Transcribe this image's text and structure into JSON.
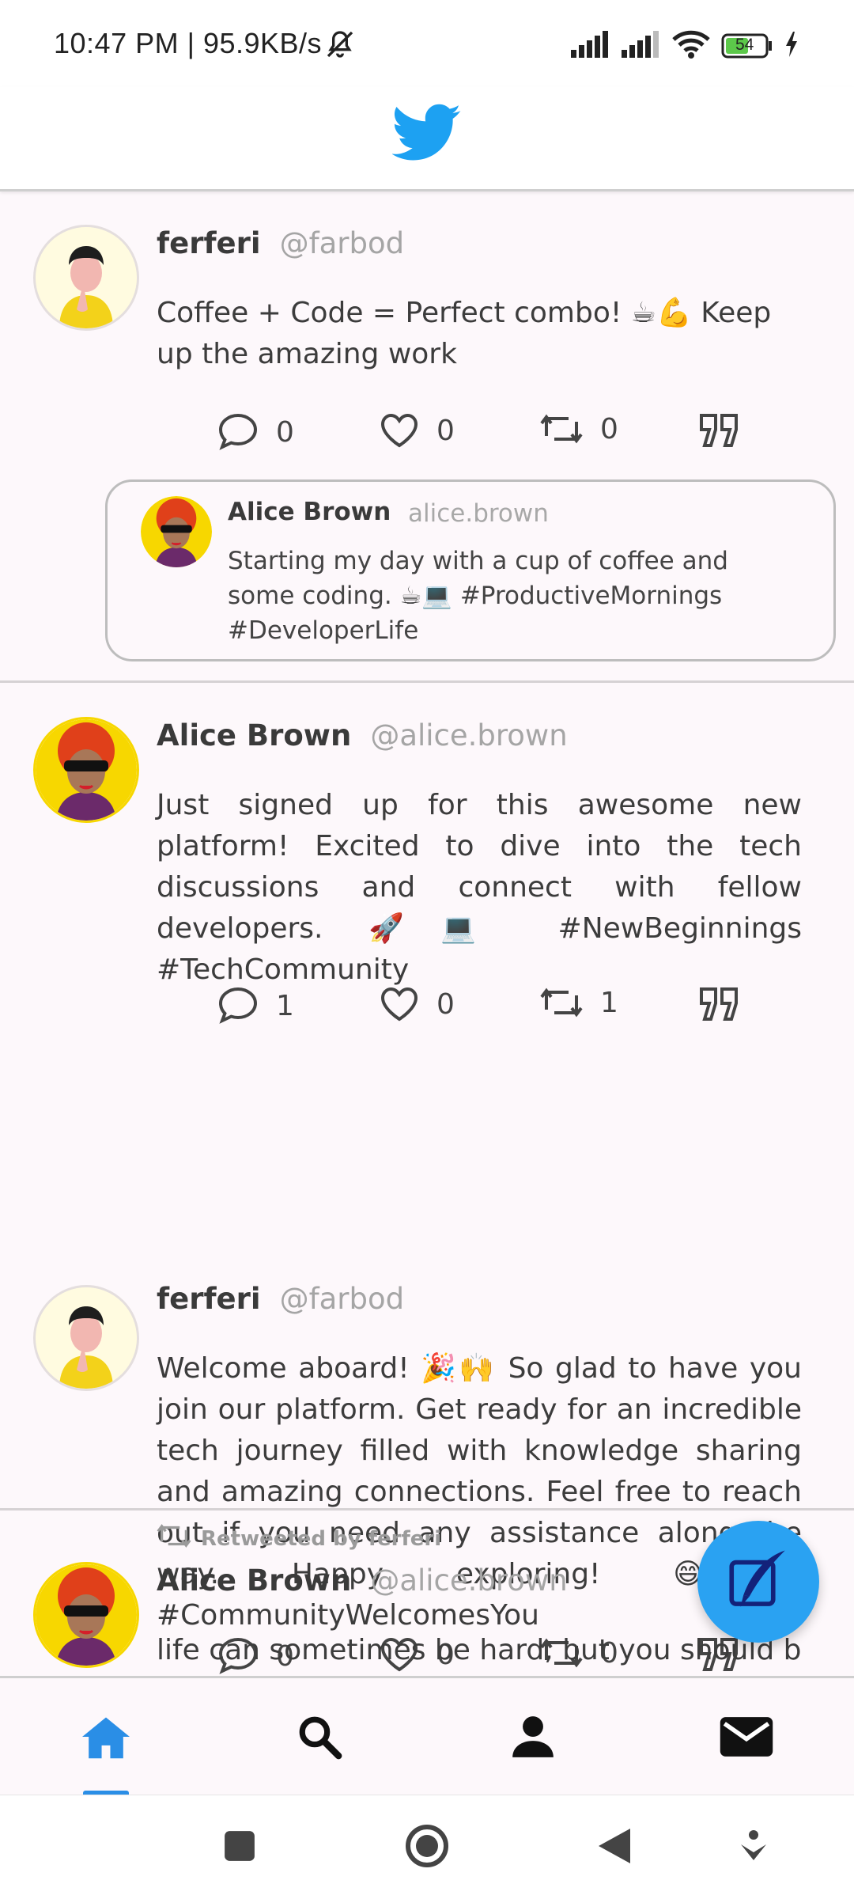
{
  "status_bar": {
    "time_speed": "10:47 PM | 95.9KB/s",
    "battery": "54"
  },
  "app": {
    "logo": "twitter-bird-icon",
    "brand_color": "#1da1f2"
  },
  "posts": [
    {
      "name": "ferferi",
      "handle": "@farbod",
      "text": "Coffee + Code = Perfect combo! ☕💪 Keep up the amazing work",
      "replies": "0",
      "likes": "0",
      "retweets": "0",
      "quote": {
        "name": "Alice Brown",
        "handle": "alice.brown",
        "text": "Starting my day with a cup of coffee and some coding. ☕💻 #ProductiveMornings #DeveloperLife"
      }
    },
    {
      "name": "Alice Brown",
      "handle": "@alice.brown",
      "text": "Just signed up for this awesome new platform! Excited to dive into the tech discussions and connect with fellow developers. 🚀💻 #NewBeginnings #TechCommunity",
      "replies": "1",
      "likes": "0",
      "retweets": "1"
    },
    {
      "name": "ferferi",
      "handle": "@farbod",
      "text": "Welcome aboard! 🎉🙌 So glad to have you join our platform. Get ready for an incredible tech journey filled with knowledge sharing and amazing connections. Feel free to reach out if you need any assistance along the way. Happy exploring! 😄💡 #CommunityWelcomesYou",
      "replies": "0",
      "likes": "0",
      "retweets": "0"
    },
    {
      "retweeted_by": "Retweeted by ferferi",
      "name": "Alice Brown",
      "handle": "@alice.brown",
      "text": "life can sometimes be hard, but you should be"
    }
  ],
  "bottom_nav": [
    "home-icon",
    "search-icon",
    "profile-icon",
    "mail-icon"
  ],
  "system_nav": [
    "recents-square-icon",
    "home-circle-icon",
    "back-triangle-icon",
    "assistant-icon"
  ]
}
